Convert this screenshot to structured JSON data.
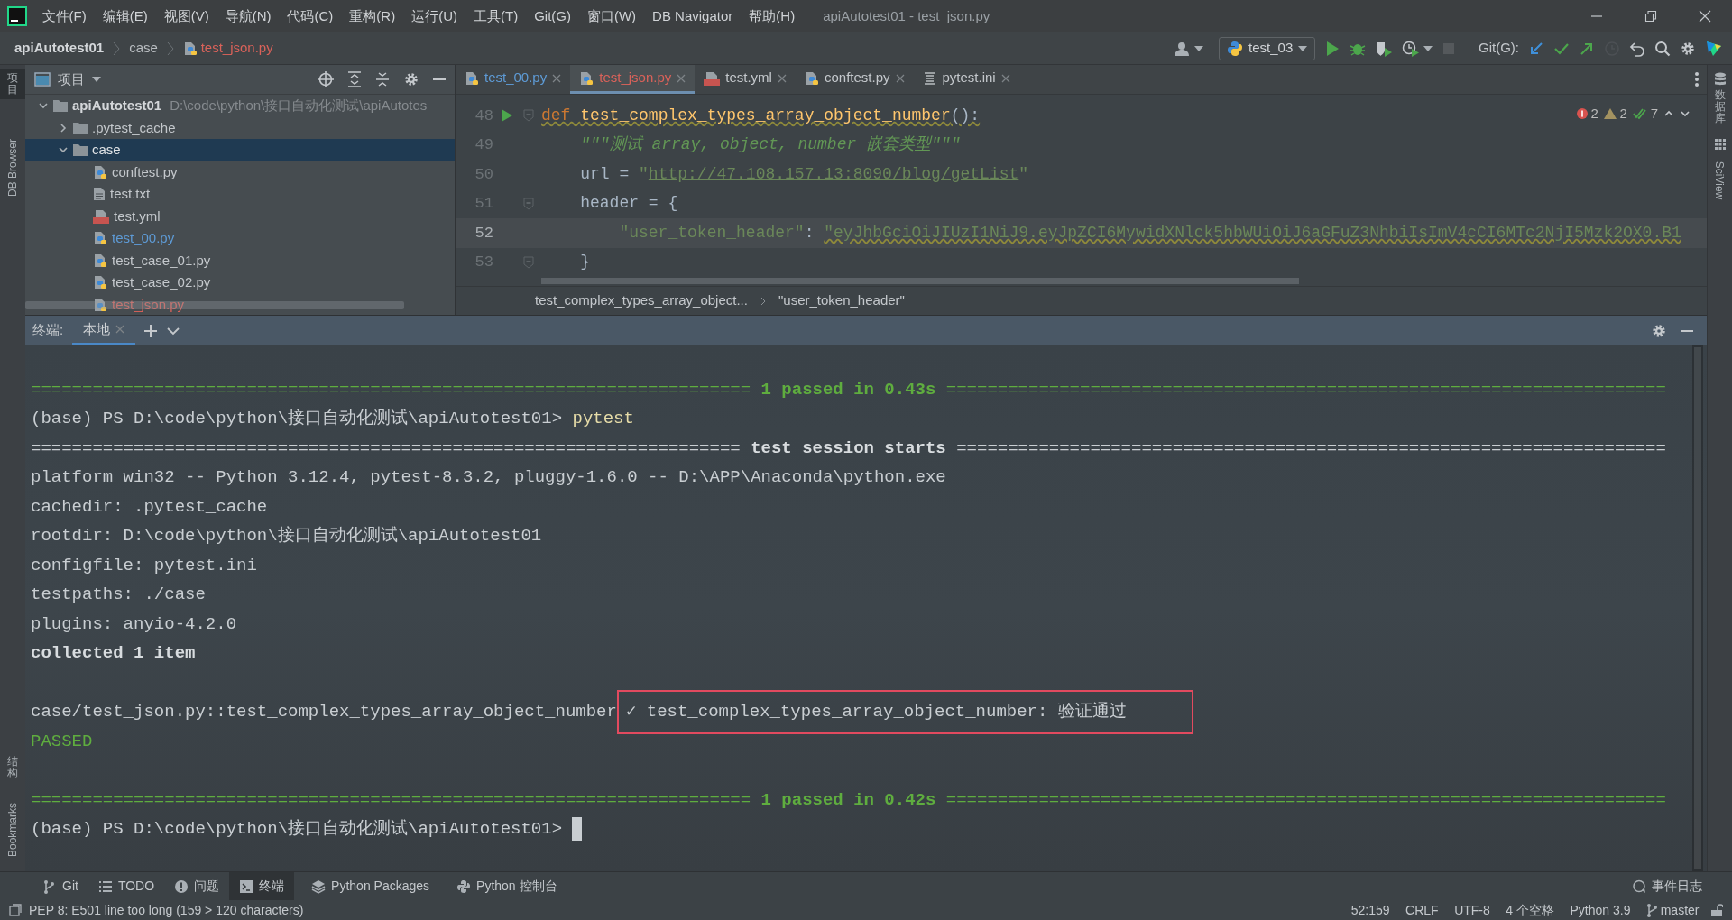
{
  "window": {
    "title": "apiAutotest01 - test_json.py"
  },
  "menu": [
    "文件(F)",
    "编辑(E)",
    "视图(V)",
    "导航(N)",
    "代码(C)",
    "重构(R)",
    "运行(U)",
    "工具(T)",
    "Git(G)",
    "窗口(W)",
    "DB Navigator",
    "帮助(H)"
  ],
  "breadcrumb": [
    {
      "label": "apiAutotest01",
      "kind": "project",
      "color": "#d4d7da"
    },
    {
      "label": "case",
      "kind": "folder",
      "color": "#b9bdc1"
    },
    {
      "label": "test_json.py",
      "kind": "python",
      "color": "#d9625a"
    }
  ],
  "toolbar": {
    "run_config": "test_03",
    "git_label": "Git(G):"
  },
  "left_strip": [
    {
      "label": "项目",
      "kind": "cjk",
      "selected": true
    },
    {
      "label": "DB Browser",
      "kind": "latin",
      "selected": false
    },
    {
      "label": "结构",
      "kind": "cjk",
      "selected": false
    },
    {
      "label": "Bookmarks",
      "kind": "latin",
      "selected": false
    }
  ],
  "right_strip": [
    {
      "label": "数据库",
      "kind": "cjk"
    },
    {
      "label": "SciView",
      "kind": "latin"
    }
  ],
  "project": {
    "title": "项目",
    "tree": [
      {
        "label": "apiAutotest01",
        "path": "D:\\code\\python\\接口自动化测试\\apiAutotes",
        "kind": "folder",
        "color": "#d4d7da",
        "expanded": true,
        "selected": false,
        "children": [
          {
            "label": ".pytest_cache",
            "kind": "folder",
            "color": "#c4c8cc",
            "expanded": false,
            "selected": false
          },
          {
            "label": "case",
            "kind": "folder",
            "expanded": true,
            "selected": true,
            "children": [
              {
                "label": "conftest.py",
                "kind": "python",
                "color": "#c4c8cc",
                "selected": false
              },
              {
                "label": "test.txt",
                "kind": "text",
                "color": "#c4c8cc",
                "selected": false
              },
              {
                "label": "test.yml",
                "kind": "yml",
                "color": "#c4c8cc",
                "selected": false
              },
              {
                "label": "test_00.py",
                "kind": "python",
                "color": "#5e9bd6",
                "selected": false
              },
              {
                "label": "test_case_01.py",
                "kind": "python",
                "color": "#c4c8cc",
                "selected": false
              },
              {
                "label": "test_case_02.py",
                "kind": "python",
                "color": "#c4c8cc",
                "selected": false
              },
              {
                "label": "test_json.py",
                "kind": "python",
                "color": "#d9625a",
                "selected": false
              }
            ]
          }
        ]
      }
    ]
  },
  "editor": {
    "tabs": [
      {
        "label": "test_00.py",
        "kind": "python",
        "color": "#5e9bd6",
        "selected": false
      },
      {
        "label": "test_json.py",
        "kind": "python",
        "color": "#d9625a",
        "selected": true
      },
      {
        "label": "test.yml",
        "kind": "yml",
        "color": "#c4c8cc",
        "selected": false
      },
      {
        "label": "conftest.py",
        "kind": "python",
        "color": "#c4c8cc",
        "selected": false
      },
      {
        "label": "pytest.ini",
        "kind": "ini",
        "color": "#c4c8cc",
        "selected": false
      }
    ],
    "inspections": {
      "errors": "2",
      "warnings": "2",
      "weak": "7"
    },
    "lines": [
      {
        "number": "48",
        "run": true,
        "fold": true,
        "current": false,
        "warning": true,
        "tokens": [
          {
            "text": "def ",
            "kind": "keyword"
          },
          {
            "text": "test_complex_types_array_object_number",
            "kind": "function"
          },
          {
            "text": "():",
            "kind": "text"
          }
        ]
      },
      {
        "number": "49",
        "run": false,
        "fold": false,
        "current": false,
        "warning": false,
        "tokens": [
          {
            "text": "    \"\"\"测试 array, object, number 嵌套类型\"\"\"",
            "kind": "docstring"
          }
        ]
      },
      {
        "number": "50",
        "run": false,
        "fold": false,
        "current": false,
        "warning": false,
        "tokens": [
          {
            "text": "    url = ",
            "kind": "text"
          },
          {
            "text": "\"",
            "kind": "string"
          },
          {
            "text": "http://47.108.157.13:8090/blog/getList",
            "kind": "url"
          },
          {
            "text": "\"",
            "kind": "string"
          }
        ]
      },
      {
        "number": "51",
        "run": false,
        "fold": true,
        "current": false,
        "warning": false,
        "tokens": [
          {
            "text": "    header = {",
            "kind": "text"
          }
        ]
      },
      {
        "number": "52",
        "run": false,
        "fold": false,
        "current": true,
        "warning": false,
        "tokens": [
          {
            "text": "        \"user_token_header\"",
            "kind": "string"
          },
          {
            "text": ": ",
            "kind": "text"
          },
          {
            "text": "\"eyJhbGciOiJIUzI1NiJ9.eyJpZCI6MywidXNlck5hbWUiOiJ6aGFuZ3NhbiIsImV4cCI6MTc2NjI5Mzk2OX0.B1",
            "kind": "long-string"
          }
        ]
      },
      {
        "number": "53",
        "run": false,
        "fold": true,
        "current": false,
        "warning": false,
        "tokens": [
          {
            "text": "    }",
            "kind": "text"
          }
        ]
      }
    ],
    "breadcrumb": [
      "test_complex_types_array_object...",
      "\"user_token_header\""
    ]
  },
  "terminal": {
    "label": "终端:",
    "tabs": [
      {
        "label": "本地",
        "selected": true
      }
    ],
    "lines": [
      [
        {
          "kind": "blank"
        }
      ],
      [
        {
          "text": "======================================================================",
          "kind": "sep"
        },
        {
          "text": " 1 passed in 0.43s ",
          "kind": "sep-title"
        },
        {
          "text": "======================================================================",
          "kind": "sep"
        }
      ],
      [
        {
          "text": "(base) PS D:\\code\\python\\接口自动化测试\\apiAutotest01> ",
          "kind": "text"
        },
        {
          "text": "pytest",
          "kind": "command"
        }
      ],
      [
        {
          "text": "=====================================================================",
          "kind": "rule"
        },
        {
          "text": " test session starts ",
          "kind": "bold"
        },
        {
          "text": "=====================================================================",
          "kind": "rule"
        }
      ],
      [
        {
          "text": "platform win32 -- Python 3.12.4, pytest-8.3.2, pluggy-1.6.0 -- D:\\APP\\Anaconda\\python.exe",
          "kind": "text"
        }
      ],
      [
        {
          "text": "cachedir: .pytest_cache",
          "kind": "text"
        }
      ],
      [
        {
          "text": "rootdir: D:\\code\\python\\接口自动化测试\\apiAutotest01",
          "kind": "text"
        }
      ],
      [
        {
          "text": "configfile: pytest.ini",
          "kind": "text"
        }
      ],
      [
        {
          "text": "testpaths: ./case",
          "kind": "text"
        }
      ],
      [
        {
          "text": "plugins: anyio-4.2.0",
          "kind": "text"
        }
      ],
      [
        {
          "text": "collected 1 item",
          "kind": "bold"
        }
      ],
      [
        {
          "kind": "blank"
        }
      ],
      [
        {
          "text": "case/test_json.py::test_complex_types_array_object_number",
          "kind": "text"
        },
        {
          "text": "✓ test_complex_types_array_object_number: 验证通过",
          "kind": "highlight"
        }
      ],
      [
        {
          "text": "PASSED",
          "kind": "pass"
        }
      ],
      [
        {
          "kind": "blank"
        }
      ],
      [
        {
          "text": "======================================================================",
          "kind": "sep"
        },
        {
          "text": " 1 passed in 0.42s ",
          "kind": "sep-title"
        },
        {
          "text": "======================================================================",
          "kind": "sep"
        }
      ],
      [
        {
          "text": "(base) PS D:\\code\\python\\接口自动化测试\\apiAutotest01> ",
          "kind": "text"
        },
        {
          "kind": "cursor"
        }
      ]
    ]
  },
  "tool_windows": [
    {
      "label": "Git",
      "kind": "branch",
      "selected": false
    },
    {
      "label": "TODO",
      "kind": "list",
      "selected": false
    },
    {
      "label": "问题",
      "kind": "problem",
      "selected": false
    },
    {
      "label": "终端",
      "kind": "terminal",
      "selected": true
    },
    {
      "label": "Python Packages",
      "kind": "layers",
      "selected": false
    },
    {
      "label": "Python 控制台",
      "kind": "python",
      "selected": false
    }
  ],
  "event_log": "事件日志",
  "status_bar": {
    "message": "PEP 8: E501 line too long (159 > 120 characters)",
    "items": [
      "52:159",
      "CRLF",
      "UTF-8",
      "4 个空格",
      "Python 3.9"
    ],
    "branch": "master"
  }
}
